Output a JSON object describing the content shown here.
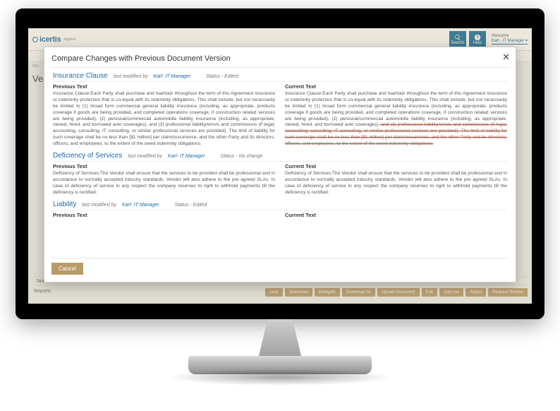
{
  "brand": {
    "name": "icertis",
    "tagline": "Applied"
  },
  "header": {
    "searchLabel": "Search",
    "helpLabel": "Help",
    "welcome": "Welcome",
    "user": "Karl - IT Manager"
  },
  "crumb": "Ho...",
  "pageTitle": "Ve...",
  "notesLabel": "Notes",
  "reportsLabel": "Reports",
  "actions": [
    "Lock",
    "Download",
    "Delegate",
    "Download All",
    "Upload Document",
    "Edit",
    "Approve",
    "Reject",
    "Request Review"
  ],
  "modal": {
    "title": "Compare Changes with Previous Document Version",
    "prevHeader": "Previous Text",
    "currHeader": "Current Text",
    "lastModifiedLabel": "last modified by",
    "statusLabel": "Status",
    "cancel": "Cancel",
    "sections": [
      {
        "name": "Insurance Clause",
        "modifiedBy": "Karl- IT Manager",
        "status": "Edited",
        "prev": "Insurance Clause:Each Party shall purchase and maintain throughout the term of this Agreement insurance or indemnity protection that is co-equal with its indemnity obligations. This shall include, but not necessarily be limited to (1) broad form commercial general liability insurance (including, as appropriate, products coverage if goods are being provided, and completed operations coverage, if construction related services are being provided), (2) personal/commercial automobile liability insurance (including, as appropriate, owned, hired, and borrowed auto coverages), and (3) professional liability/errors and commissions (if legal, accounting, consulting, IT consulting, or similar professional services are provided). The limit of liability for such coverage shall be no less than [$1 million] per claim/occurrence, and the other Party and its directors, officers, and employees, to the extent of the owed indemnity obligations.",
        "currPlain": "Insurance Clause:Each Party shall purchase and maintain throughout the term of this Agreement insurance or indemnity protection that is co-equal with its indemnity obligations. This shall include, but not necessarily be limited to (1) broad form commercial general liability insurance (including, as appropriate, products coverage if goods are being provided, and completed operations coverage, if construction related services are being provided), (2) personal/commercial automobile liability insurance (including, as appropriate, owned, hired, and borrowed auto coverages),",
        "currStruck": " and (3) professional liability/errors and commissions (if legal, accounting, consulting, IT consulting, or similar professional services are provided). The limit of liability for such coverage shall be no less than [$1 million] per claim/occurrence, and the other Party and its directors, officers, and employees, to the extent of the owed indemnity obligations."
      },
      {
        "name": "Deficiency of Services",
        "modifiedBy": "Karl- IT Manager",
        "status": "No change",
        "prev": "Deficiency of Services:The Vendor shall ensure that the services to be provided shall be professional and in accordance to normally accepted industry standards. Vendor will also adhere to the pre agreed SLAs. In case of deficiency of service in any respect the company reserves to right to withhold payments till the deficiency is rectified.",
        "currPlain": "Deficiency of Services:The Vendor shall ensure that the services to be provided shall be professional and in accordance to normally accepted industry standards. Vendor will also adhere to the pre agreed SLAs. In case of deficiency of service in any respect the company reserves to right to withhold payments till the deficiency is rectified.",
        "currStruck": ""
      },
      {
        "name": "Liability",
        "modifiedBy": "Karl- IT Manager",
        "status": "Edited",
        "prev": "",
        "currPlain": "",
        "currStruck": ""
      }
    ]
  }
}
